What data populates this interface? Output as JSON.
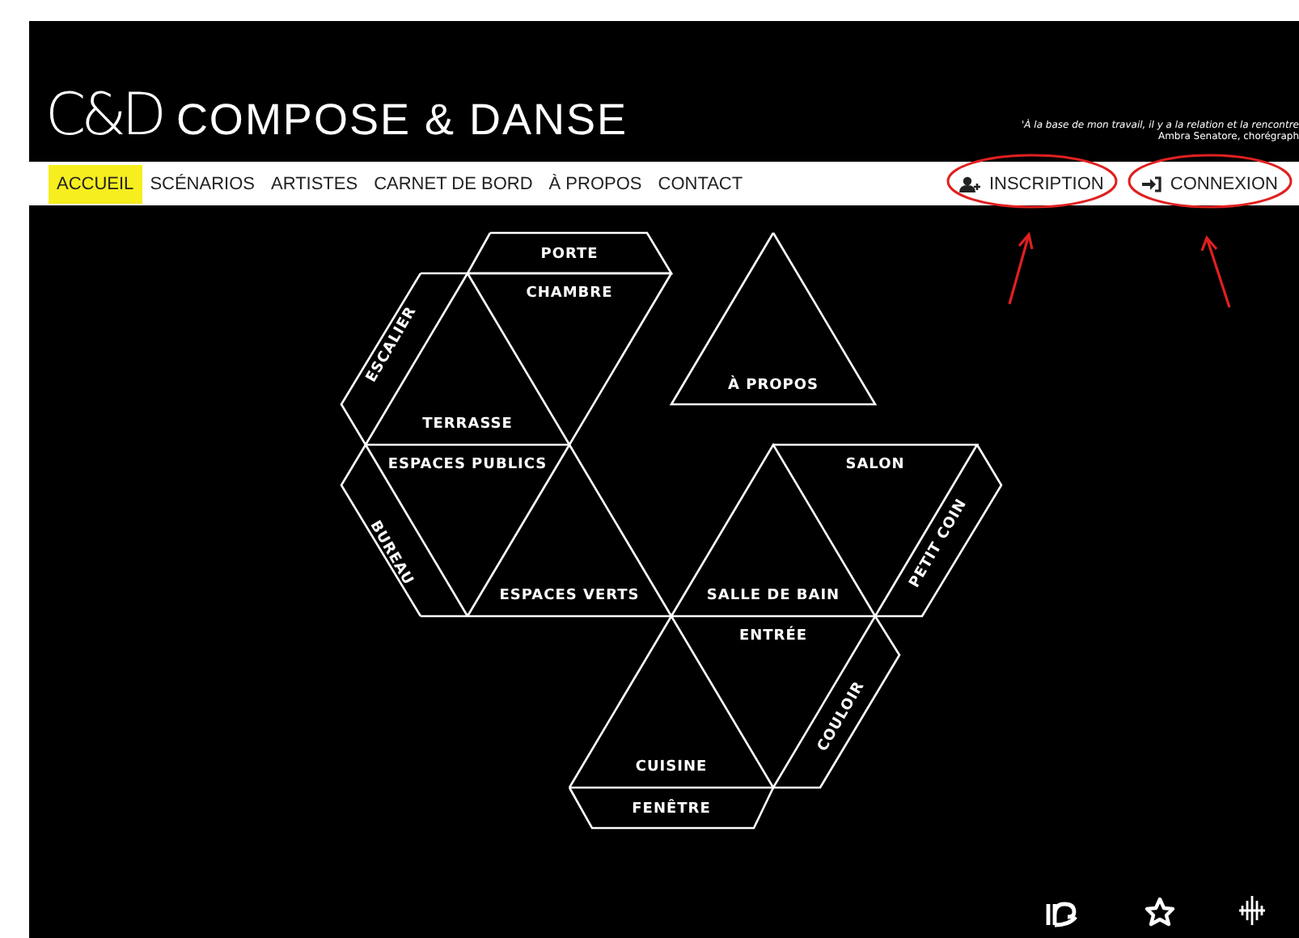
{
  "header": {
    "logo_monogram": "C&D",
    "site_title": "COMPOSE & DANSE",
    "quote": "'À la base de mon travail, il y a la relation et la rencontre",
    "quote_author": "Ambra Senatore, chorégraph"
  },
  "nav": {
    "items": [
      {
        "label": "ACCUEIL",
        "selected": true
      },
      {
        "label": "SCÉNARIOS",
        "selected": false
      },
      {
        "label": "ARTISTES",
        "selected": false
      },
      {
        "label": "CARNET DE BORD",
        "selected": false
      },
      {
        "label": "À PROPOS",
        "selected": false
      },
      {
        "label": "CONTACT",
        "selected": false
      }
    ],
    "buttons": [
      {
        "label": "INSCRIPTION",
        "kind": "register"
      },
      {
        "label": "CONNEXION",
        "kind": "login"
      }
    ]
  },
  "diagram": {
    "rooms": [
      {
        "label": "PORTE"
      },
      {
        "label": "CHAMBRE"
      },
      {
        "label": "ESCALIER"
      },
      {
        "label": "TERRASSE"
      },
      {
        "label": "ESPACES PUBLICS"
      },
      {
        "label": "BUREAU"
      },
      {
        "label": "ESPACES VERTS"
      },
      {
        "label": "À PROPOS"
      },
      {
        "label": "SALON"
      },
      {
        "label": "PETIT COIN"
      },
      {
        "label": "SALLE DE BAIN"
      },
      {
        "label": "ENTRÉE"
      },
      {
        "label": "COULOIR"
      },
      {
        "label": "CUISINE"
      },
      {
        "label": "FENÊTRE"
      }
    ]
  }
}
